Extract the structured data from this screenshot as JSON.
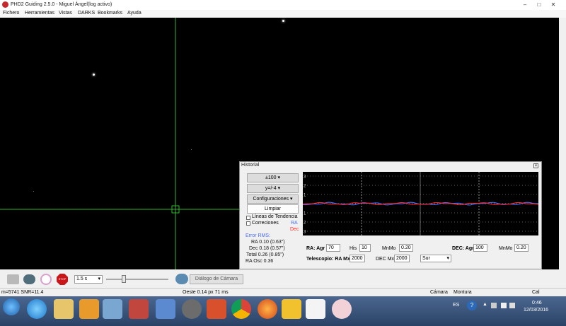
{
  "window": {
    "title": "PHD2 Guiding 2.5.0 - Miguel Ángel(log activo)"
  },
  "menu": [
    "Fichero",
    "Herramientas",
    "Vistas",
    "DARKS",
    "Bookmarks",
    "Ayuda"
  ],
  "history": {
    "title": "Historial",
    "x_scale": "±100",
    "y_scale": "y=/-4",
    "settings": "Configuraciones",
    "clear": "Limpiar",
    "trend_lines": "Líneas de Tendencia",
    "corrections": "Correciones",
    "ra_label": "RA",
    "dec_label": "Dec",
    "rms_title": "Error RMS:",
    "rms_ra": "RA 0.10 (0.63\")",
    "rms_dec": "Dec 0.18 (0.57\")",
    "rms_total": "Total 0.26 (0.85\")",
    "ra_osc": "RA Osc 0.36",
    "y_ticks": [
      "3",
      "2",
      "1",
      "",
      "1",
      "2",
      "3"
    ],
    "ra": {
      "label": "RA: Agr",
      "agr": "70",
      "his_label": "His",
      "his": "10",
      "minmo_label": "MnMo",
      "minmo": "0.20"
    },
    "dec": {
      "label": "DEC: Agr",
      "agr": "100",
      "minmo_label": "MnMo",
      "minmo": "0.20"
    },
    "telescope": {
      "label": "Telescopio: RA Mx",
      "ra_mx": "2000",
      "dec_mx_label": "DEC Mx",
      "dec_mx": "2000",
      "dir": "Sur"
    },
    "colors": {
      "ra": "#4a6cff",
      "dec": "#ff2a2a"
    }
  },
  "toolbar": {
    "exposure": "1.5 s",
    "camera_dialog": "Diálogo de Cámara"
  },
  "status": {
    "star": "m=5741 SNR=11.4",
    "guide": "Oeste 0.14 px 71 ms",
    "camera": "Cámara",
    "mount": "Montura",
    "cal": "Cal"
  },
  "taskbar": {
    "lang": "ES",
    "time": "0:46",
    "date": "12/03/2016"
  }
}
